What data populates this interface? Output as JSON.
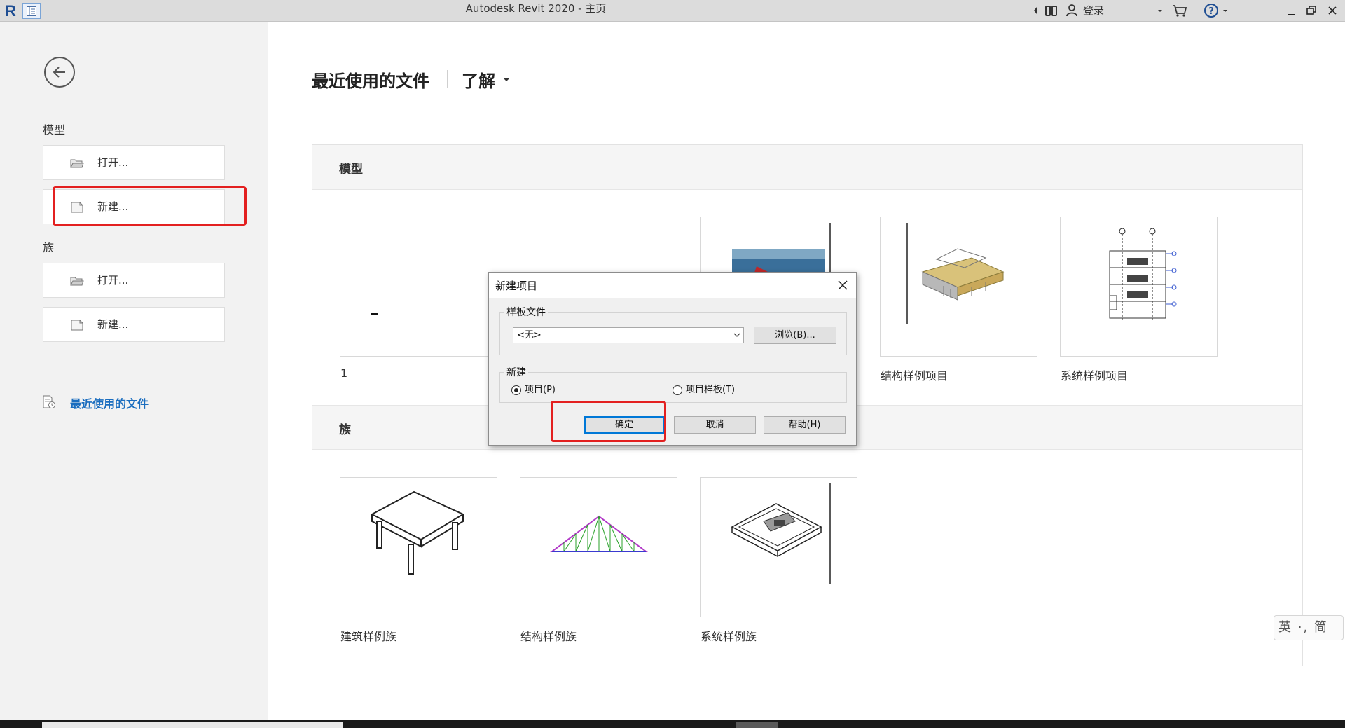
{
  "window": {
    "title": "Autodesk Revit 2020 - 主页",
    "login_label": "登录"
  },
  "sidebar": {
    "model_section": "模型",
    "model_open": "打开...",
    "model_new": "新建...",
    "family_section": "族",
    "family_open": "打开...",
    "family_new": "新建...",
    "recent_files": "最近使用的文件"
  },
  "main": {
    "title": "最近使用的文件",
    "learn_tab": "了解",
    "models_header": "模型",
    "families_header": "族",
    "models": [
      {
        "label": "1",
        "icon": "blank-thumb"
      },
      {
        "label": "",
        "icon": "blank-thumb"
      },
      {
        "label": "",
        "icon": "render-thumb"
      },
      {
        "label": "结构样例项目",
        "icon": "structure-thumb"
      },
      {
        "label": "系统样例项目",
        "icon": "systems-thumb"
      }
    ],
    "families": [
      {
        "label": "建筑样例族",
        "icon": "table-thumb"
      },
      {
        "label": "结构样例族",
        "icon": "truss-thumb"
      },
      {
        "label": "系统样例族",
        "icon": "fixture-thumb"
      }
    ]
  },
  "dialog": {
    "title": "新建项目",
    "template_group": "样板文件",
    "template_value": "<无>",
    "browse_button": "浏览(B)...",
    "new_group": "新建",
    "radio_project": "项目(P)",
    "radio_template": "项目样板(T)",
    "selected": "project",
    "ok": "确定",
    "cancel": "取消",
    "help": "帮助(H)"
  },
  "ime": {
    "label": "英 ·, 简"
  },
  "colors": {
    "highlight_red": "#e32020",
    "link_blue": "#1a6dbf",
    "default_button_border": "#0078d7"
  }
}
